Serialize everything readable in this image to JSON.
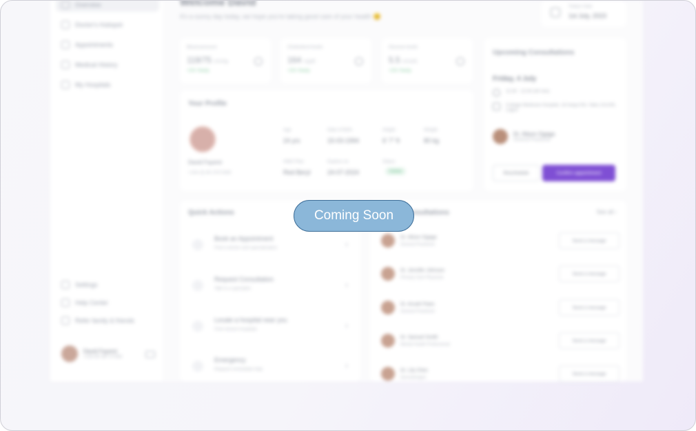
{
  "sidebar": {
    "items": [
      {
        "label": "Overview",
        "icon": "home-icon"
      },
      {
        "label": "Doctor's Hubspot",
        "icon": "doctor-icon"
      },
      {
        "label": "Appointments",
        "icon": "calendar-icon"
      },
      {
        "label": "Medical History",
        "icon": "file-icon"
      },
      {
        "label": "My Hospitals",
        "icon": "hospital-icon"
      }
    ],
    "bottom": [
      {
        "label": "Settings",
        "icon": "gear-icon"
      },
      {
        "label": "Help Center",
        "icon": "help-icon"
      },
      {
        "label": "Refer family & friends",
        "icon": "gift-icon"
      }
    ],
    "user": {
      "name": "David Fayemi",
      "sub": "+234 80 387 57456"
    }
  },
  "header": {
    "title": "Welcome David",
    "subtitle": "It's a sunny day today, we hope you're taking good care of your health 😊",
    "date_label": "Today's Date",
    "date_value": "1st July, 2023"
  },
  "stats": [
    {
      "label": "Blood pressure",
      "value": "118/75",
      "unit": "mmHg",
      "delta": "+2%",
      "delta_sub": "Yearly"
    },
    {
      "label": "Cholesterol levels",
      "value": "164",
      "unit": "mg/dl",
      "delta": "+2%",
      "delta_sub": "Yearly"
    },
    {
      "label": "Glucose levels",
      "value": "5.5",
      "unit": "mmol/L",
      "delta": "+2%",
      "delta_sub": "Yearly"
    }
  ],
  "profile": {
    "title": "Your Profile",
    "name": "David Fayemi",
    "id": "+234 (0) 80 378 5456",
    "fields": [
      {
        "k": "Age",
        "v": "24 yrs"
      },
      {
        "k": "Date of Birth",
        "v": "15-03-1994"
      },
      {
        "k": "Height",
        "v": "6' 7\" ft"
      },
      {
        "k": "Weight",
        "v": "80 kg"
      },
      {
        "k": "HMO Plan",
        "v": "Red Beryl"
      },
      {
        "k": "Expires on",
        "v": "24-07-2024"
      },
      {
        "k": "Status",
        "v": "Active"
      }
    ]
  },
  "upcoming": {
    "title": "Upcoming Consultations",
    "day": "Friday, 4 July",
    "time": "11:30 - 12:00 (30 min)",
    "location": "Cottage Medicare Hospital, 18 Iwaya Rd, Yaba 101245, Lagos",
    "doctor": "Dr. Alison Ogaga",
    "role": "General Practioner",
    "reschedule": "Reschedule",
    "confirm": "Confirm appointment"
  },
  "quick_actions": {
    "title": "Quick Actions",
    "items": [
      {
        "title": "Book an Appointment",
        "sub": "Find a doctor and specialization"
      },
      {
        "title": "Request Consultation",
        "sub": "Talk to a specialist"
      },
      {
        "title": "Locate a hospital near you",
        "sub": "Find closest hospitals"
      },
      {
        "title": "Emergency",
        "sub": "Request immediate help"
      }
    ]
  },
  "recent": {
    "title": "Recent Consultations",
    "see_all": "See all",
    "items": [
      {
        "name": "Dr. Alison Ogaga",
        "role": "General Practioner",
        "button": "Send a message"
      },
      {
        "name": "Dr. Jennifer Johnson",
        "role": "Primary Care Physician",
        "button": "Send a message"
      },
      {
        "name": "Dr. Ansah Paws",
        "role": "General Practioner",
        "button": "Send a message"
      },
      {
        "name": "Dr. Samuel Smith",
        "role": "Mental Health Professional",
        "button": "Send a message"
      },
      {
        "name": "Dr. Lily Chen",
        "role": "Dermatologist",
        "button": "Send a message"
      }
    ]
  },
  "overlay": {
    "label": "Coming Soon"
  }
}
